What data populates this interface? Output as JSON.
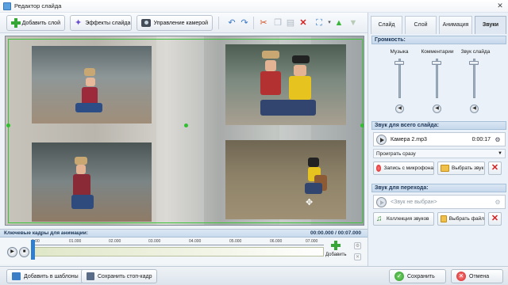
{
  "window": {
    "title": "Редактор слайда",
    "close": "✕"
  },
  "toolbar": {
    "add_layer": "Добавить слой",
    "slide_effects": "Эффекты слайда",
    "camera_control": "Управление камерой"
  },
  "tabs": [
    "Слайд",
    "Слой",
    "Анимация",
    "Звуки"
  ],
  "volume": {
    "title": "Громкость:",
    "music": "Музыка",
    "comments": "Комментарии",
    "slide_sound": "Звук слайда"
  },
  "slide_sound": {
    "title": "Звук для всего слайда:",
    "file": "Камера 2.mp3",
    "time": "0:00:17",
    "play_mode": "Проиграть сразу",
    "record": "Запись с микрофона",
    "choose": "Выбрать звук"
  },
  "transition_sound": {
    "title": "Звук для перехода:",
    "file": "<Звук не выбран>",
    "collection": "Коллекция звуков",
    "choose_file": "Выбрать файл"
  },
  "timeline": {
    "title": "Ключевые кадры для анимации:",
    "time": "00:00.000 / 00:07.000",
    "ticks": [
      "0.00",
      "01.000",
      "02.000",
      "03.000",
      "04.000",
      "05.000",
      "06.000",
      "07.000"
    ],
    "add": "Добавить"
  },
  "bottom": {
    "add_template": "Добавить в шаблоны",
    "save_frame": "Сохранить стоп-кадр",
    "save": "Сохранить",
    "cancel": "Отмена"
  }
}
